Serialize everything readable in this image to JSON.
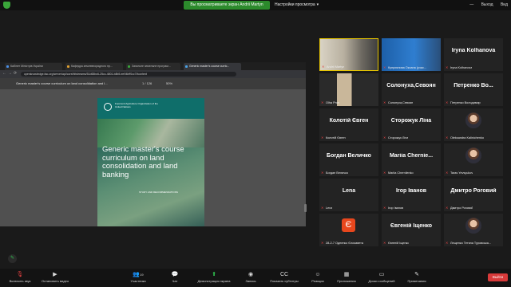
{
  "topbar": {
    "banner": "Вы просматриваете экран Andrii Martyn",
    "view_options": "Настройки просмотра",
    "exit_label": "Выход",
    "view_label": "Вид"
  },
  "browser": {
    "tabs": [
      {
        "label": "Кабінет Міністрів України",
        "color": "#4a8fe7"
      },
      {
        "label": "Кафедра землевпорядного пр...",
        "color": "#e0a030"
      },
      {
        "label": "Загальне земельне програм...",
        "color": "#3aa53a"
      },
      {
        "label": "Generic master's course curric...",
        "color": "#4aa3e7"
      }
    ],
    "url": "openknowledge.fao.org/server/api/core/bitstreams/51d65bc6-25cc-4801-b8b5-ee94bff0cc7f/content",
    "pdf_title": "Generic master's course curriculum on land consolidation and l...",
    "page_current": "1",
    "page_total": "/ 126",
    "zoom": "50%"
  },
  "cover": {
    "org_name": "Food and Agriculture Organization of the United Nations",
    "title": "Generic master's course curriculum on land consolidation and land banking",
    "subtitle": "STUDY AND RECOMMENDATIONS"
  },
  "participants": [
    {
      "display": "video",
      "label": "Andrii Martyn",
      "active": true
    },
    {
      "display": "video",
      "label": "Куприянова Оксана (учас..."
    },
    {
      "display": "name",
      "name": "Iryna Kolhanova",
      "label": "Iryna Kolhanova"
    },
    {
      "display": "video",
      "label": "Olha Pron"
    },
    {
      "display": "name",
      "name": "Солонуха,Севоян",
      "label": "Солонуха,Севоян"
    },
    {
      "display": "name",
      "name": "Петренко Во...",
      "label": "Петренко Володимир"
    },
    {
      "display": "name",
      "name": "Колотій Євген",
      "label": "Колотій Євген"
    },
    {
      "display": "name",
      "name": "Сторожук Ліна",
      "label": "Сторожук Ліна"
    },
    {
      "display": "avatar",
      "label": "Oleksandra Kalinichenko"
    },
    {
      "display": "name",
      "name": "Богдан Величко",
      "label": "Богдан Величко"
    },
    {
      "display": "name",
      "name": "Mariia Chernie...",
      "label": "Mariia Chernilenko"
    },
    {
      "display": "avatar",
      "label": "Taras Yevsyukov"
    },
    {
      "display": "name",
      "name": "Lena",
      "label": "Lena"
    },
    {
      "display": "name",
      "name": "Ігор Іванов",
      "label": "Ігор Іванов"
    },
    {
      "display": "name",
      "name": "Дмитро Роговий",
      "label": "Дмитро Роговий"
    },
    {
      "display": "letter",
      "letter": "Є",
      "label": "28-2-7 Одненко Єлизавета"
    },
    {
      "display": "name",
      "name": "Євгеній Іщенко",
      "label": "Євгеній Іщенко"
    },
    {
      "display": "avatar",
      "label": "Лещенко Тетяна Туровська..."
    }
  ],
  "toolbar": {
    "mic": "Включить звук",
    "video": "Остановить видео",
    "participants": "Участники",
    "participants_count": "19",
    "chat": "Чат",
    "share": "Демонстрация экрана",
    "record": "Запись",
    "captions": "Показать субтитры",
    "reactions": "Реакции",
    "apps": "Приложения",
    "whiteboards": "Доски сообщений",
    "notes": "Примечания",
    "end": "Выйти"
  },
  "colors": {
    "accent_green": "#2fbf4f",
    "end_red": "#d83a3a",
    "active_speaker": "#e6c500",
    "fao_teal": "#0f6e6a"
  }
}
